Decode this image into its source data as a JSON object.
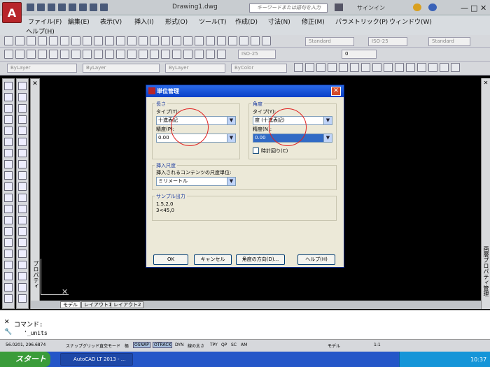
{
  "app": {
    "title": "Drawing1.dwg",
    "search_placeholder": "キーワードまたは語句を入力",
    "signin": "サインイン"
  },
  "menus": [
    "ファイル(F)",
    "編集(E)",
    "表示(V)",
    "挿入(I)",
    "形式(O)",
    "ツール(T)",
    "作成(D)",
    "寸法(N)",
    "修正(M)",
    "パラメトリック(P)",
    "ウィンドウ(W)"
  ],
  "menu_help": "ヘルプ(H)",
  "toolbar": {
    "text_style": "Standard",
    "dim_style": "ISO-25",
    "table_style": "Standard",
    "dim_style2": "ISO-25",
    "layer": "0",
    "color": "ByLayer",
    "linetype": "ByLayer",
    "lineweight": "ByLayer",
    "plotstyle": "ByColor"
  },
  "side": {
    "properties_label": "プロパティ",
    "sheet_label": "画層プロパティ管理"
  },
  "layout_tabs": [
    "モデル",
    "レイアウト1",
    "レイアウト2"
  ],
  "command": {
    "line1": "コマンド:",
    "line2": "'_units"
  },
  "status": {
    "coords": "56.0201, 296.6874",
    "toggles": [
      {
        "label": "スナップ",
        "on": false
      },
      {
        "label": "グリッド",
        "on": false
      },
      {
        "label": "直交モード",
        "on": false
      },
      {
        "label": "極",
        "on": false
      },
      {
        "label": "OSNAP",
        "on": true
      },
      {
        "label": "OTRACK",
        "on": true
      },
      {
        "label": "DYN",
        "on": false
      },
      {
        "label": "線の太さ",
        "on": false
      },
      {
        "label": "TPY",
        "on": false
      },
      {
        "label": "QP",
        "on": false
      },
      {
        "label": "SC",
        "on": false
      },
      {
        "label": "AM",
        "on": false
      }
    ],
    "model": "モデル",
    "scale": "1:1"
  },
  "taskbar": {
    "start": "スタート",
    "app": "AutoCAD LT 2013 - ...",
    "time": "10:37"
  },
  "dialog": {
    "title": "単位管理",
    "length_group": "長さ",
    "length_type_label": "タイプ(T):",
    "length_type_value": "十進表記",
    "length_precision_label": "精度(P):",
    "length_precision_value": "0.00",
    "angle_group": "角度",
    "angle_type_label": "タイプ(Y):",
    "angle_type_value": "度 (十進表記)",
    "angle_precision_label": "精度(N):",
    "angle_precision_value": "0.00",
    "clockwise_label": "時計回り(C)",
    "insert_group": "挿入尺度",
    "insert_label": "挿入されるコンテンツの尺度単位:",
    "insert_value": "ミリメートル",
    "sample_group": "サンプル出力",
    "sample_line1": "1.5,2,0",
    "sample_line2": "3<45,0",
    "buttons": {
      "ok": "OK",
      "cancel": "キャンセル",
      "direction": "角度の方向(D)...",
      "help": "ヘルプ(H)"
    }
  },
  "colors": {
    "title_blue": "#0a40c8",
    "annotation_red": "#e02020",
    "canvas": "#000000"
  }
}
